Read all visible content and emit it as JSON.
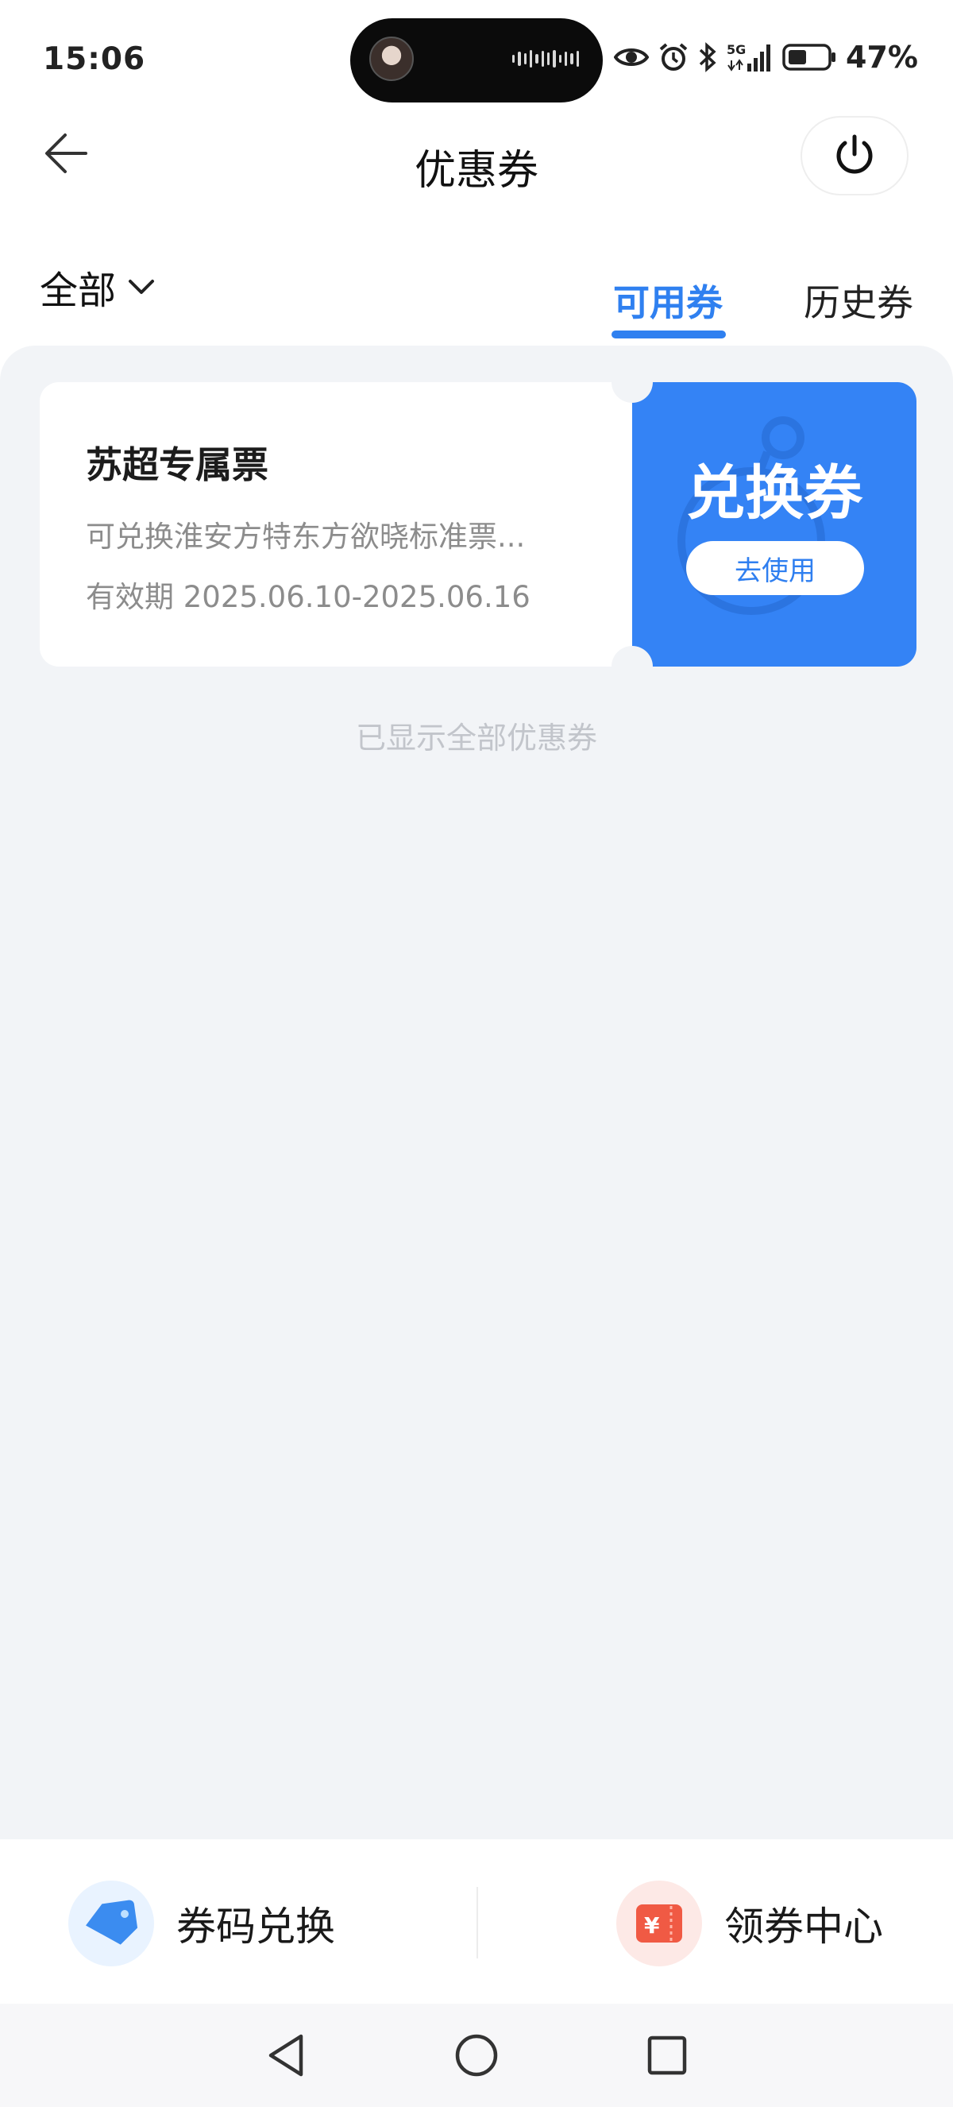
{
  "status_bar": {
    "time": "15:06",
    "network": "5G",
    "battery_percent": "47%",
    "battery_level": 0.47,
    "icons": [
      "eye-icon",
      "alarm-icon",
      "bluetooth-icon",
      "signal-5g-icon",
      "battery-icon"
    ]
  },
  "header": {
    "title": "优惠券",
    "back_icon": "arrow-left-icon",
    "power_icon": "power-icon"
  },
  "filter": {
    "label": "全部",
    "icon": "chevron-down-icon"
  },
  "tabs": [
    {
      "label": "可用券",
      "active": true
    },
    {
      "label": "历史券",
      "active": false
    }
  ],
  "coupons": [
    {
      "title": "苏超专属票",
      "description": "可兑换淮安方特东方欲晓标准票...",
      "validity": "有效期 2025.06.10-2025.06.16",
      "type": "兑换券",
      "button": "去使用"
    }
  ],
  "list_footer": "已显示全部优惠券",
  "bottom_actions": [
    {
      "label": "券码兑换",
      "icon": "tag-icon"
    },
    {
      "label": "领券中心",
      "icon": "wallet-icon"
    }
  ],
  "nav": [
    "back-triangle-icon",
    "home-circle-icon",
    "recent-square-icon"
  ],
  "colors": {
    "accent": "#2f80f0",
    "coupon_right": "#3483f5",
    "background": "#f2f4f7"
  }
}
